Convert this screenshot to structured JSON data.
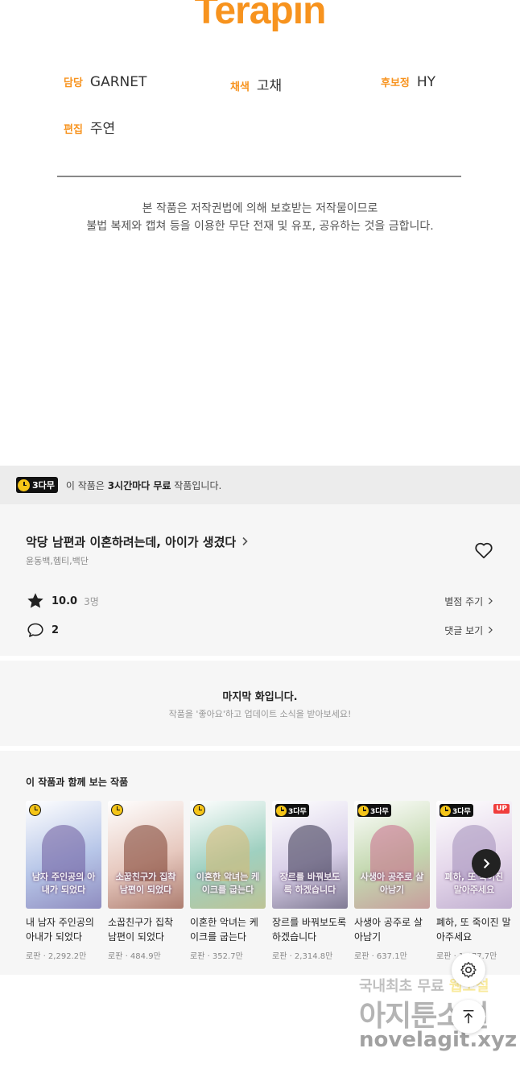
{
  "credits": {
    "studio_logo": "Terapin",
    "items": [
      {
        "role": "담당",
        "name": "GARNET"
      },
      {
        "role": "채색",
        "name": "고채"
      },
      {
        "role": "후보정",
        "name": "HY"
      },
      {
        "role": "편집",
        "name": "주연"
      }
    ],
    "copyright_line1": "본 작품은 저작권법에 의해 보호받는 저작물이므로",
    "copyright_line2": "불법 복제와 캡쳐 등을 이용한 무단 전재 및 유포, 공유하는 것을 금합니다."
  },
  "free_banner": {
    "badge": "3다무",
    "text_prefix": "이 작품은 ",
    "text_bold": "3시간마다 무료",
    "text_suffix": " 작품입니다."
  },
  "work": {
    "title": "악당 남편과 이혼하려는데, 아이가 생겼다",
    "authors": "윤동백,헴티,백단",
    "rating": "10.0",
    "votes": "3명",
    "rate_link": "별점 주기",
    "comments": "2",
    "comment_link": "댓글 보기",
    "icons": {
      "favorite": "heart-icon",
      "rating": "star-icon",
      "comment": "speech-bubble-icon",
      "chevron": "chevron-right-icon"
    }
  },
  "last_episode": {
    "title": "마지막 화입니다.",
    "subtitle": "작품을 '좋아요'하고 업데이트 소식을 받아보세요!"
  },
  "related": {
    "heading": "이 작품과 함께 보는 작품",
    "items": [
      {
        "title": "내 남자 주인공의 아내가 되었다",
        "meta": "로판 · 2,292.2만",
        "badge": "clock",
        "cover_text": "남자 주인공의 아내가 되었다",
        "cover_bg": "#b7c6e8",
        "figure": "#6c5a9c"
      },
      {
        "title": "소꿉친구가 집착 남편이 되었다",
        "meta": "로판 · 484.9만",
        "badge": "clock",
        "cover_text": "소꿉친구가 집착남편이 되었다",
        "cover_bg": "#e7c9bf",
        "figure": "#7a3a2a"
      },
      {
        "title": "이혼한 악녀는 케이크를 굽는다",
        "meta": "로판 · 352.7만",
        "badge": "clock",
        "cover_text": "이혼한 악녀는 케이크를 굽는다",
        "cover_bg": "#9fd0c0",
        "figure": "#d8b870"
      },
      {
        "title": "장르를 바꿔보도록 하겠습니다",
        "meta": "로판 · 2,314.8만",
        "badge": "3h",
        "cover_text": "장르를 바꿔보도록 하겠습니다",
        "cover_bg": "#d8cfe8",
        "figure": "#33304a"
      },
      {
        "title": "사생아 공주로 살아남기",
        "meta": "로판 · 637.1만",
        "badge": "3h",
        "cover_text": "사생아 공주로 살아남기",
        "cover_bg": "#c4d8b0",
        "figure": "#c86a8a"
      },
      {
        "title": "폐하, 또 죽이진 말아주세요",
        "meta": "로판 · 1,077.7만",
        "badge": "3h-up",
        "cover_text": "폐하, 또 죽이진 말아주세요",
        "cover_bg": "#e4d6ea",
        "figure": "#a08cb8"
      }
    ],
    "up_label": "UP",
    "three_hour_label": "3다무"
  },
  "watermark": {
    "line1_prefix": "국내최초 무료 ",
    "line1_highlight": "웹소설",
    "line2": "아지툰소설",
    "line3": "novelagit.xyz"
  },
  "colors": {
    "accent": "#f7931e",
    "badge_yellow": "#f5c518",
    "up_red": "#f03c3c"
  }
}
